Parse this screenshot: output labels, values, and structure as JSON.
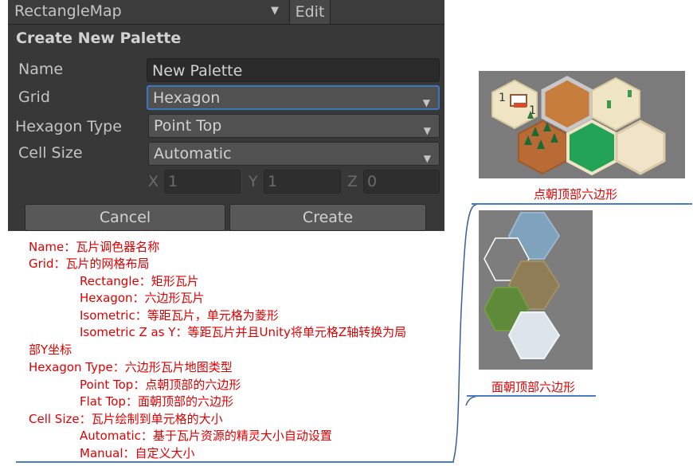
{
  "dialog": {
    "tilemap_dropdown": "RectangleMap",
    "edit_label": "Edit",
    "title": "Create New Palette",
    "name_label": "Name",
    "name_value": "New Palette",
    "grid_label": "Grid",
    "grid_value": "Hexagon",
    "hex_type_label": "Hexagon Type",
    "hex_type_value": "Point Top",
    "cell_size_label": "Cell Size",
    "cell_size_value": "Automatic",
    "x_label": "X",
    "x_value": "1",
    "y_label": "Y",
    "y_value": "1",
    "z_label": "Z",
    "z_value": "0",
    "cancel_label": "Cancel",
    "create_label": "Create"
  },
  "notes": {
    "name": "Name：瓦片调色器名称",
    "grid": "Grid：瓦片的网格布局",
    "rectangle": "Rectangle：矩形瓦片",
    "hexagon": "Hexagon：六边形瓦片",
    "isometric": "Isometric：等距瓦片，单元格为菱形",
    "isometric_z_line1": "Isometric Z as Y：等距瓦片并且Unity将单元格Z轴转换为局",
    "isometric_z_line2": "部Y坐标",
    "hex_type": "Hexagon Type：六边形瓦片地图类型",
    "point_top": "Point Top：点朝顶部的六边形",
    "flat_top": "Flat Top：面朝顶部的六边形",
    "cell_size": "Cell Size：瓦片绘制到单元格的大小",
    "automatic": "Automatic：基于瓦片资源的精灵大小自动设置",
    "manual": "Manual：自定义大小"
  },
  "captions": {
    "point_top": "点朝顶部六边形",
    "flat_top": "面朝顶部六边形"
  },
  "colors": {
    "note_red": "#e00000",
    "line_blue": "#4a7ec2",
    "focus_blue": "#3a79bb"
  }
}
